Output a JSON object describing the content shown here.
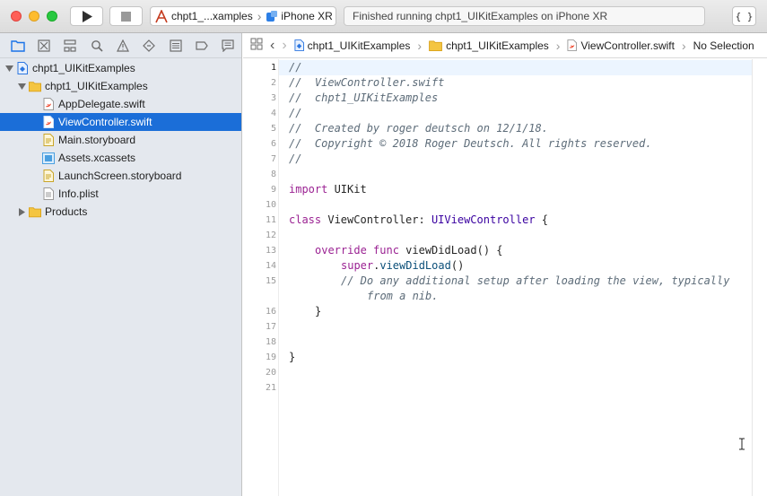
{
  "toolbar": {
    "run_icon": "play-icon",
    "stop_icon": "stop-icon",
    "scheme": {
      "target": "chpt1_...xamples",
      "device": "iPhone XR"
    },
    "activity": "Finished running chpt1_UIKitExamples on iPhone XR",
    "library_label": "{ }"
  },
  "navigator": {
    "tabs": [
      "folder-icon",
      "source-control-icon",
      "hierarchy-icon",
      "search-icon",
      "warning-icon",
      "test-diamond-icon",
      "debug-icon",
      "breakpoint-icon",
      "report-icon"
    ],
    "items": [
      {
        "label": "chpt1_UIKitExamples",
        "icon": "project-icon"
      },
      {
        "label": "chpt1_UIKitExamples",
        "icon": "folder-icon"
      },
      {
        "label": "AppDelegate.swift",
        "icon": "swift-file-icon"
      },
      {
        "label": "ViewController.swift",
        "icon": "swift-file-icon",
        "selected": true
      },
      {
        "label": "Main.storyboard",
        "icon": "storyboard-icon"
      },
      {
        "label": "Assets.xcassets",
        "icon": "assets-icon"
      },
      {
        "label": "LaunchScreen.storyboard",
        "icon": "storyboard-icon"
      },
      {
        "label": "Info.plist",
        "icon": "plist-icon"
      },
      {
        "label": "Products",
        "icon": "folder-icon"
      }
    ]
  },
  "jumpbar": {
    "items": [
      "chpt1_UIKitExamples",
      "chpt1_UIKitExamples",
      "ViewController.swift",
      "No Selection"
    ]
  },
  "editor": {
    "line_numbers": [
      "1",
      "2",
      "3",
      "4",
      "5",
      "6",
      "7",
      "8",
      "9",
      "10",
      "11",
      "12",
      "13",
      "14",
      "15",
      "",
      "16",
      "17",
      "18",
      "19",
      "20",
      "21"
    ],
    "code": {
      "l1": "//",
      "l2": "//  ViewController.swift",
      "l3": "//  chpt1_UIKitExamples",
      "l4": "//",
      "l5": "//  Created by roger deutsch on 12/1/18.",
      "l6": "//  Copyright © 2018 Roger Deutsch. All rights reserved.",
      "l7": "//",
      "l9_kw": "import",
      "l9_rest": " UIKit",
      "l11_kw": "class",
      "l11_name": " ViewController: ",
      "l11_super": "UIViewController",
      "l11_end": " {",
      "l13_kw1": "override",
      "l13_kw2": "func",
      "l13_rest": " viewDidLoad() {",
      "l14_kw": "super",
      "l14_dot": ".",
      "l14_call": "viewDidLoad",
      "l14_end": "()",
      "l15a": "// Do any additional setup after loading the view, typically",
      "l15b": "from a nib.",
      "l16": "}",
      "l19": "}"
    }
  }
}
